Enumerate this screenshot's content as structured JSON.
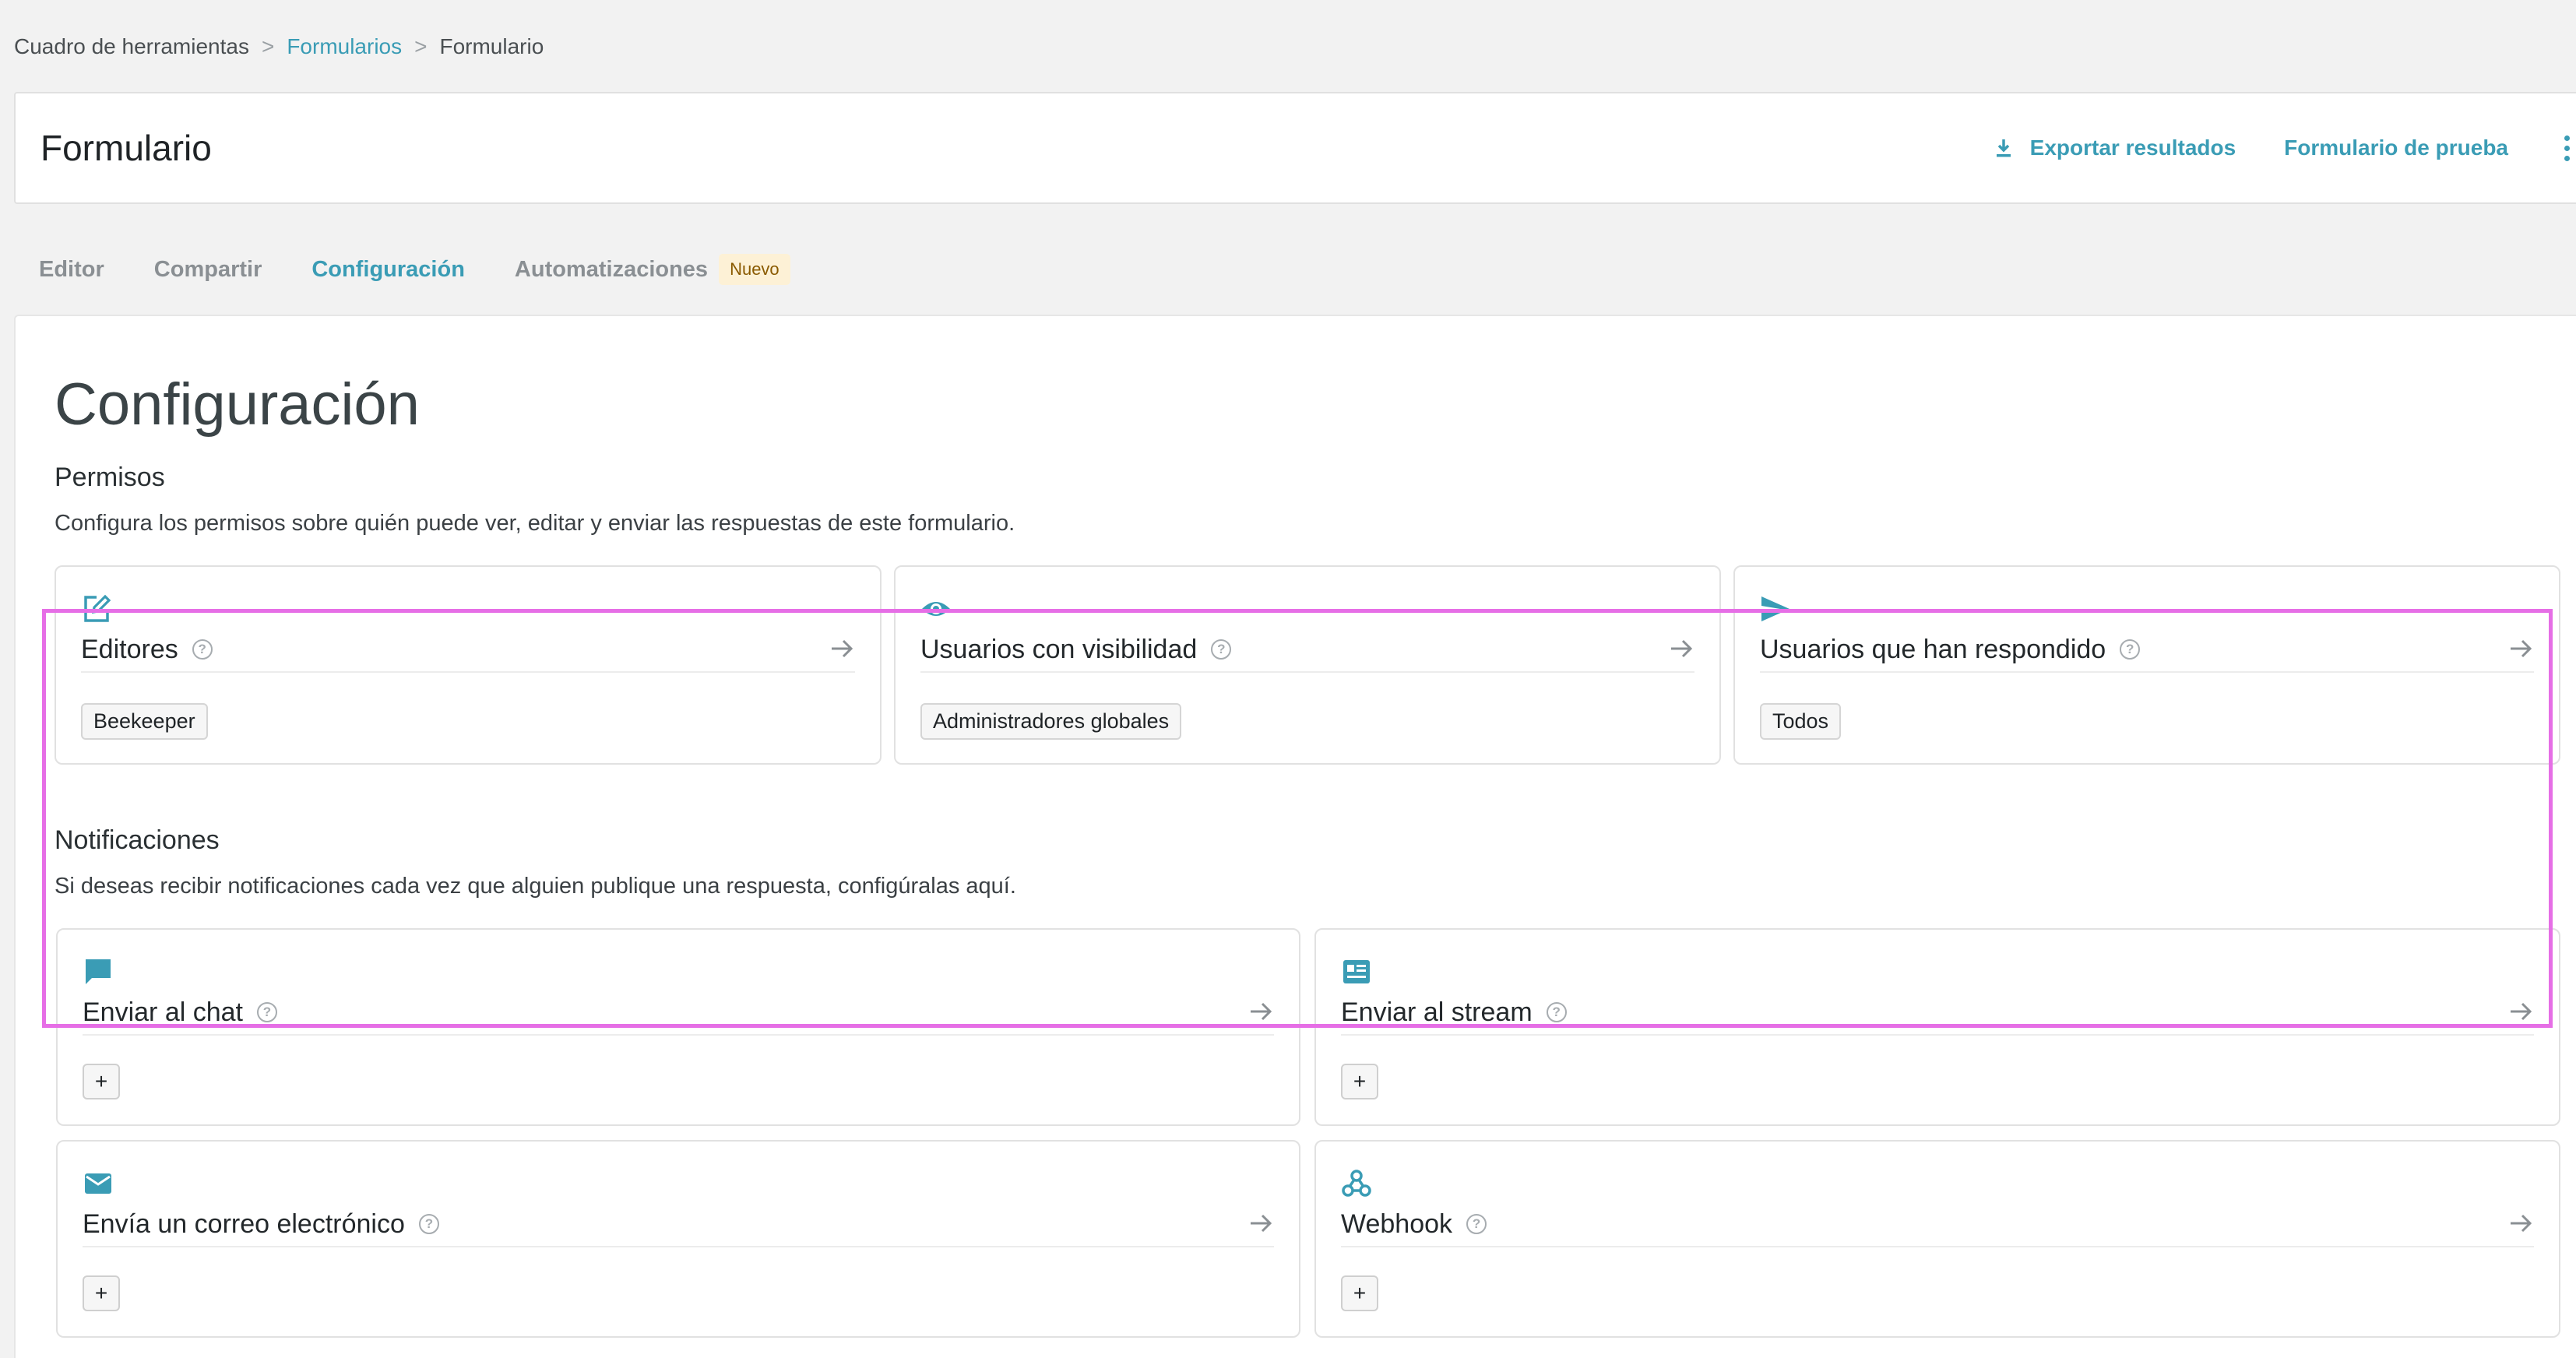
{
  "breadcrumb": {
    "root": "Cuadro de herramientas",
    "separator": ">",
    "forms": "Formularios",
    "current": "Formulario"
  },
  "header": {
    "title": "Formulario",
    "export_label": "Exportar resultados",
    "test_label": "Formulario de prueba"
  },
  "tabs": {
    "editor": "Editor",
    "share": "Compartir",
    "settings": "Configuración",
    "automations": "Automatizaciones",
    "new_badge": "Nuevo"
  },
  "page": {
    "title": "Configuración"
  },
  "permissions": {
    "title": "Permisos",
    "description": "Configura los permisos sobre quién puede ver, editar y enviar las respuestas de este formulario.",
    "help_glyph": "?",
    "cards": [
      {
        "title": "Editores",
        "tag": "Beekeeper"
      },
      {
        "title": "Usuarios con visibilidad",
        "tag": "Administradores globales"
      },
      {
        "title": "Usuarios que han respondido",
        "tag": "Todos"
      }
    ]
  },
  "notifications": {
    "title": "Notificaciones",
    "description": "Si deseas recibir notificaciones cada vez que alguien publique una respuesta, configúralas aquí.",
    "add_label": "+",
    "cards": [
      {
        "title": "Enviar al chat"
      },
      {
        "title": "Enviar al stream"
      },
      {
        "title": "Envía un correo electrónico"
      },
      {
        "title": "Webhook"
      }
    ]
  },
  "colors": {
    "accent": "#3a9cb5",
    "highlight": "#e66ee6",
    "badge_bg": "#fdf1d6"
  }
}
